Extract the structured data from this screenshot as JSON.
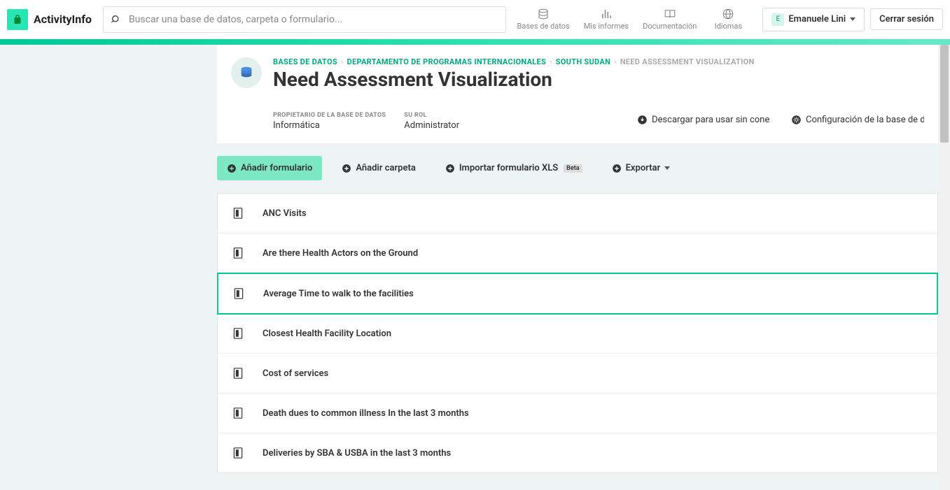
{
  "brand": "ActivityInfo",
  "search": {
    "placeholder": "Buscar una base de datos, carpeta o formulario..."
  },
  "nav": {
    "databases": "Bases de datos",
    "reports": "Mis informes",
    "docs": "Documentación",
    "languages": "Idiomas"
  },
  "user": {
    "name": "Emanuele Lini",
    "initial": "E"
  },
  "logout": "Cerrar sesión",
  "breadcrumb": {
    "l0": "BASES DE DATOS",
    "l1": "DEPARTAMENTO DE PROGRAMAS INTERNACIONALES",
    "l2": "SOUTH SUDAN",
    "current": "NEED ASSESSMENT VISUALIZATION"
  },
  "page_title": "Need Assessment Visualization",
  "meta": {
    "owner_label": "PROPIETARIO DE LA BASE DE DATOS",
    "owner_value": "Informática",
    "role_label": "SU ROL",
    "role_value": "Administrator",
    "download": "Descargar para usar sin conexi...",
    "config": "Configuración de la base de dat..."
  },
  "actions": {
    "add_form": "Añadir formulario",
    "add_folder": "Añadir carpeta",
    "import": "Importar formulario XLS",
    "import_badge": "Beta",
    "export": "Exportar"
  },
  "forms": [
    {
      "label": "ANC Visits"
    },
    {
      "label": "Are there Health Actors on the Ground"
    },
    {
      "label": "Average Time to walk to the facilities",
      "selected": true
    },
    {
      "label": "Closest Health Facility Location"
    },
    {
      "label": "Cost of services"
    },
    {
      "label": "Death dues to common illness In the last 3 months"
    },
    {
      "label": "Deliveries by SBA & USBA in the last 3 months"
    }
  ]
}
